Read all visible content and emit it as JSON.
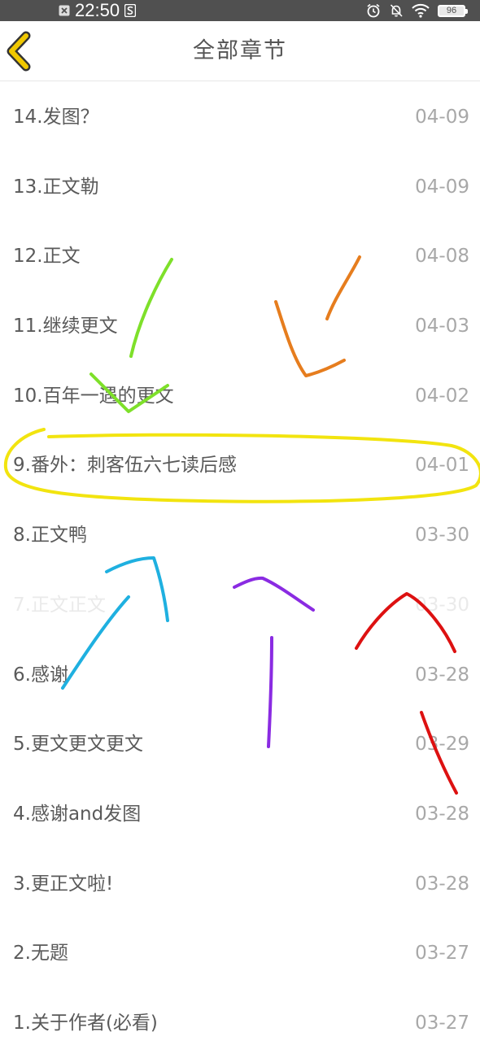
{
  "status_bar": {
    "time": "22:50",
    "battery": "96",
    "icons": [
      "close-box-icon",
      "s-app-icon",
      "alarm-icon",
      "bell-off-icon",
      "wifi-icon",
      "battery-icon"
    ]
  },
  "header": {
    "title": "全部章节",
    "back_icon": "chevron-left-icon"
  },
  "chapters": [
    {
      "title": "14.发图？",
      "date": "04-09"
    },
    {
      "title": "13.正文勒",
      "date": "04-09"
    },
    {
      "title": "12.正文",
      "date": "04-08"
    },
    {
      "title": "11.继续更文",
      "date": "04-03"
    },
    {
      "title": "10.百年一遇的更文",
      "date": "04-02"
    },
    {
      "title": "9.番外：刺客伍六七读后感",
      "date": "04-01"
    },
    {
      "title": "8.正文鸭",
      "date": "03-30"
    },
    {
      "title": "7.正文正文",
      "date": "03-30"
    },
    {
      "title": "6.感谢",
      "date": "03-28"
    },
    {
      "title": "5.更文更文更文",
      "date": "03-29"
    },
    {
      "title": "4.感谢and发图",
      "date": "03-28"
    },
    {
      "title": "3.更正文啦!",
      "date": "03-28"
    },
    {
      "title": "2.无题",
      "date": "03-27"
    },
    {
      "title": "1.关于作者(必看)",
      "date": "03-27"
    }
  ],
  "colors": {
    "status_bar": "#505050",
    "back_arrow": "#f0c800",
    "annotation_yellow": "#f2e40f",
    "annotation_green": "#7ee02a",
    "annotation_orange": "#e67d1e",
    "annotation_blue": "#1fb0e0",
    "annotation_purple": "#8a2be2",
    "annotation_red": "#dd1111"
  }
}
